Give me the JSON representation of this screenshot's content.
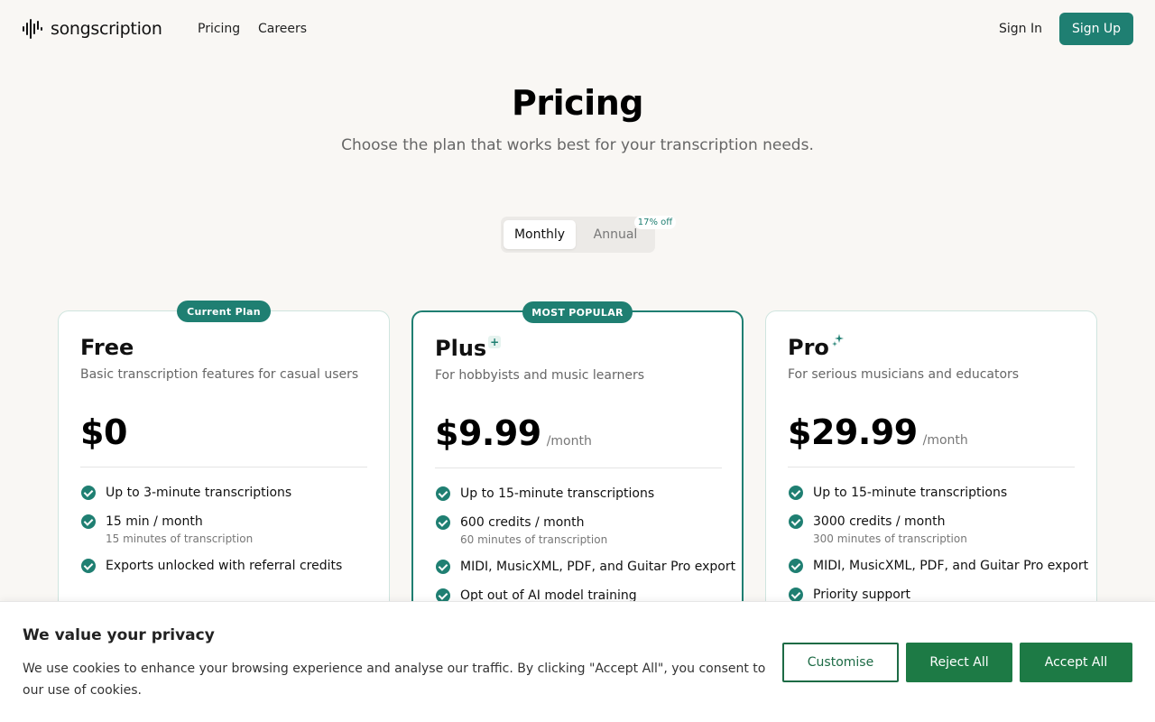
{
  "nav": {
    "brand": "songscription",
    "links": [
      "Pricing",
      "Careers"
    ],
    "sign_in": "Sign In",
    "sign_up": "Sign Up"
  },
  "hero": {
    "title": "Pricing",
    "subtitle": "Choose the plan that works best for your transcription needs."
  },
  "billing": {
    "monthly": "Monthly",
    "annual": "Annual",
    "discount": "17% off",
    "selected": "Monthly"
  },
  "plans": [
    {
      "badge": "Current Plan",
      "name": "Free",
      "description": "Basic transcription features for casual users",
      "price": "$0",
      "period": "",
      "features": [
        {
          "text": "Up to 3-minute transcriptions",
          "sub": ""
        },
        {
          "text": "15 min / month",
          "sub": "15 minutes of transcription"
        },
        {
          "text": "Exports unlocked with referral credits",
          "sub": ""
        }
      ]
    },
    {
      "badge": "MOST POPULAR",
      "name": "Plus",
      "name_icon": "+",
      "description": "For hobbyists and music learners",
      "price": "$9.99",
      "period": "/month",
      "features": [
        {
          "text": "Up to 15-minute transcriptions",
          "sub": ""
        },
        {
          "text": "600 credits / month",
          "sub": "60 minutes of transcription"
        },
        {
          "text": "MIDI, MusicXML, PDF, and Guitar Pro export",
          "sub": ""
        },
        {
          "text": "Opt out of AI model training",
          "sub": ""
        }
      ]
    },
    {
      "badge": "",
      "name": "Pro",
      "name_icon": "sparkle-icon",
      "description": "For serious musicians and educators",
      "price": "$29.99",
      "period": "/month",
      "features": [
        {
          "text": "Up to 15-minute transcriptions",
          "sub": ""
        },
        {
          "text": "3000 credits / month",
          "sub": "300 minutes of transcription"
        },
        {
          "text": "MIDI, MusicXML, PDF, and Guitar Pro export",
          "sub": ""
        },
        {
          "text": "Priority support",
          "sub": ""
        }
      ]
    }
  ],
  "cookie": {
    "title": "We value your privacy",
    "text": "We use cookies to enhance your browsing experience and analyse our traffic. By clicking \"Accept All\", you consent to our use of cookies.",
    "customise": "Customise",
    "reject": "Reject All",
    "accept": "Accept All"
  },
  "colors": {
    "accent": "#1f7f72",
    "cookie_button": "#1d7a45",
    "background": "#f9f7f4"
  }
}
